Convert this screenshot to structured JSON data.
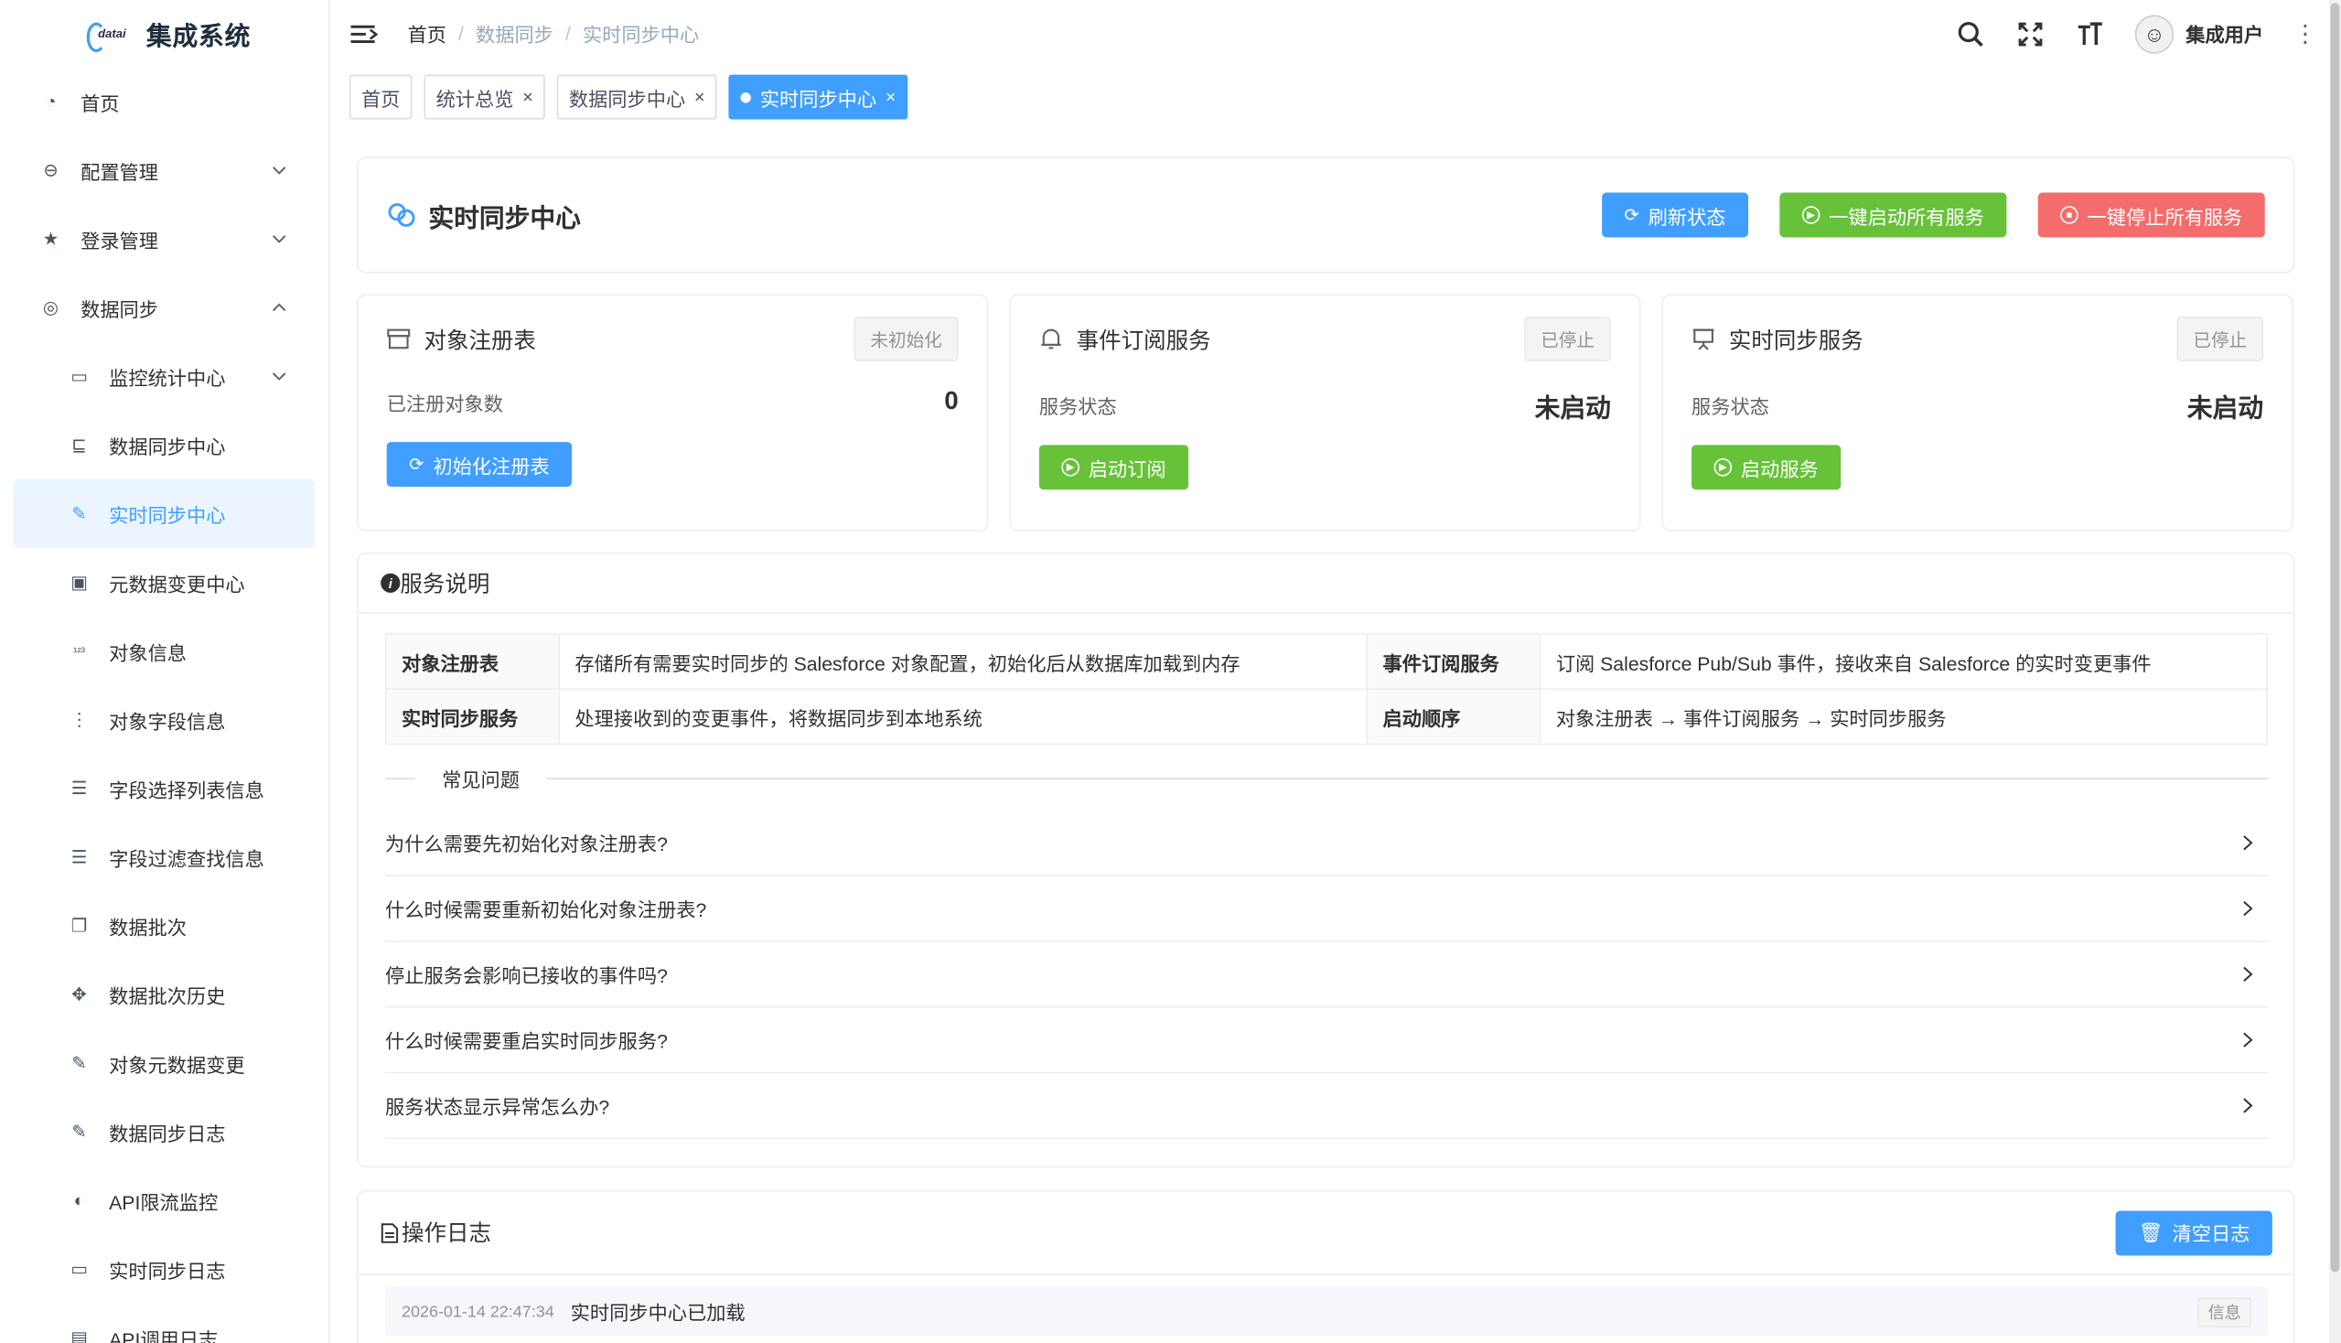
{
  "app": {
    "logo_text": "datai",
    "title": "集成系统"
  },
  "sidebar": {
    "items": [
      {
        "label": "首页",
        "icon": "dashboard-icon",
        "level": 1
      },
      {
        "label": "配置管理",
        "icon": "toggle-icon",
        "level": 1,
        "chevron": "down"
      },
      {
        "label": "登录管理",
        "icon": "star-icon",
        "level": 1,
        "chevron": "down"
      },
      {
        "label": "数据同步",
        "icon": "palette-icon",
        "level": 1,
        "chevron": "up"
      },
      {
        "label": "监控统计中心",
        "icon": "monitor-icon",
        "level": 2,
        "chevron": "down"
      },
      {
        "label": "数据同步中心",
        "icon": "tree-icon",
        "level": 2
      },
      {
        "label": "实时同步中心",
        "icon": "edit-icon",
        "level": 2,
        "active": true
      },
      {
        "label": "元数据变更中心",
        "icon": "screen-icon",
        "level": 2
      },
      {
        "label": "对象信息",
        "icon": "number-icon",
        "level": 2
      },
      {
        "label": "对象字段信息",
        "icon": "more-vertical-icon",
        "level": 2
      },
      {
        "label": "字段选择列表信息",
        "icon": "list-tree-icon",
        "level": 2
      },
      {
        "label": "字段过滤查找信息",
        "icon": "list-icon",
        "level": 2
      },
      {
        "label": "数据批次",
        "icon": "copy-icon",
        "level": 2
      },
      {
        "label": "数据批次历史",
        "icon": "move-icon",
        "level": 2
      },
      {
        "label": "对象元数据变更",
        "icon": "edit-icon",
        "level": 2
      },
      {
        "label": "数据同步日志",
        "icon": "log-edit-icon",
        "level": 2
      },
      {
        "label": "API限流监控",
        "icon": "gauge-icon",
        "level": 2
      },
      {
        "label": "实时同步日志",
        "icon": "monitor-icon",
        "level": 2
      },
      {
        "label": "API调用日志",
        "icon": "doc-icon",
        "level": 2
      }
    ]
  },
  "header": {
    "breadcrumb": [
      "首页",
      "数据同步",
      "实时同步中心"
    ],
    "user_name": "集成用户"
  },
  "tags": [
    {
      "label": "首页",
      "closable": false,
      "active": false
    },
    {
      "label": "统计总览",
      "closable": true,
      "active": false
    },
    {
      "label": "数据同步中心",
      "closable": true,
      "active": false
    },
    {
      "label": "实时同步中心",
      "closable": true,
      "active": true
    }
  ],
  "page": {
    "title": "实时同步中心",
    "actions": {
      "refresh": "刷新状态",
      "start_all": "一键启动所有服务",
      "stop_all": "一键停止所有服务"
    }
  },
  "services": [
    {
      "title": "对象注册表",
      "status": "未初始化",
      "key": "已注册对象数",
      "value": "0",
      "button": "初始化注册表",
      "button_color": "blue"
    },
    {
      "title": "事件订阅服务",
      "status": "已停止",
      "key": "服务状态",
      "value": "未启动",
      "button": "启动订阅",
      "button_color": "green"
    },
    {
      "title": "实时同步服务",
      "status": "已停止",
      "key": "服务状态",
      "value": "未启动",
      "button": "启动服务",
      "button_color": "green"
    }
  ],
  "info": {
    "title": "服务说明",
    "rows": [
      [
        {
          "k": "对象注册表",
          "v": "存储所有需要实时同步的 Salesforce 对象配置，初始化后从数据库加载到内存"
        },
        {
          "k": "事件订阅服务",
          "v": "订阅 Salesforce Pub/Sub 事件，接收来自 Salesforce 的实时变更事件"
        }
      ],
      [
        {
          "k": "实时同步服务",
          "v": "处理接收到的变更事件，将数据同步到本地系统"
        },
        {
          "k": "启动顺序",
          "v": "对象注册表 → 事件订阅服务 → 实时同步服务"
        }
      ]
    ],
    "faq_title": "常见问题",
    "faq": [
      "为什么需要先初始化对象注册表?",
      "什么时候需要重新初始化对象注册表?",
      "停止服务会影响已接收的事件吗?",
      "什么时候需要重启实时同步服务?",
      "服务状态显示异常怎么办?"
    ]
  },
  "log": {
    "title": "操作日志",
    "clear": "清空日志",
    "entries": [
      {
        "time": "2026-01-14 22:47:34",
        "msg": "实时同步中心已加载",
        "level": "信息"
      }
    ]
  },
  "colors": {
    "primary": "#409eff",
    "success": "#67c23a",
    "danger": "#f56c6c"
  }
}
